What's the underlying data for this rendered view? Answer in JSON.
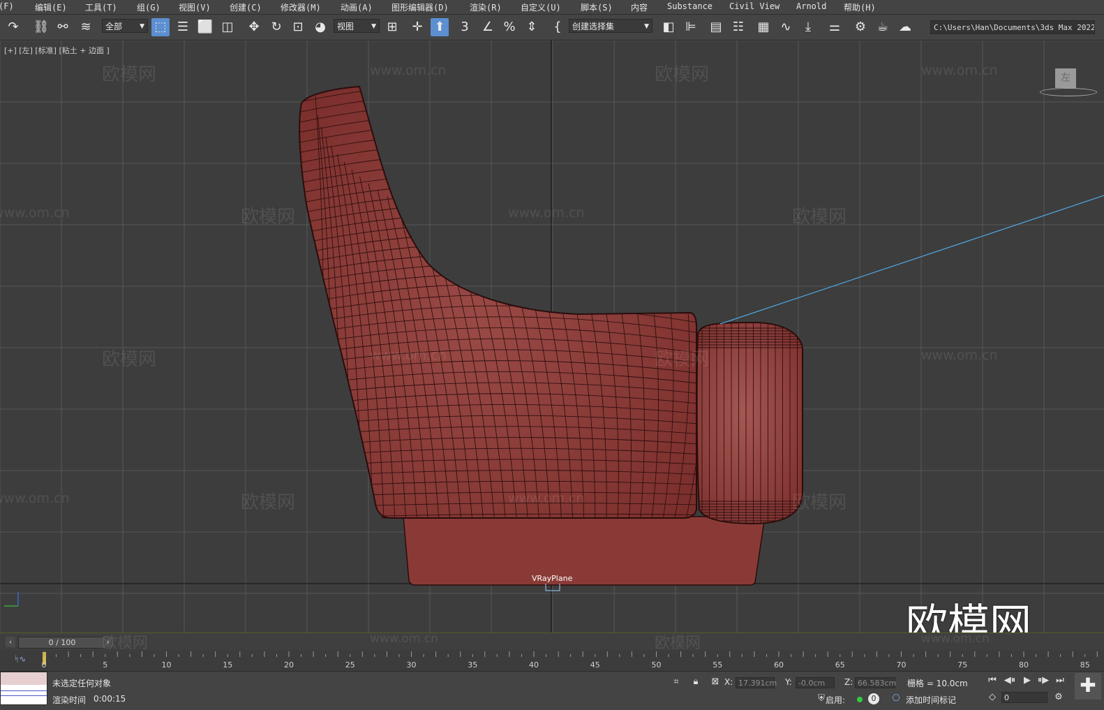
{
  "menu": {
    "items": [
      "(F)",
      "编辑(E)",
      "工具(T)",
      "组(G)",
      "视图(V)",
      "创建(C)",
      "修改器(M)",
      "动画(A)",
      "图形编辑器(D)",
      "渲染(R)",
      "自定义(U)",
      "脚本(S)",
      "内容",
      "Substance",
      "Civil View",
      "Arnold",
      "帮助(H)"
    ]
  },
  "toolbar": {
    "selection_filter": "全部",
    "ref_coord": "视图",
    "named_selection": "创建选择集",
    "project_path": "C:\\Users\\Han\\Documents\\3ds Max 2022",
    "snap_label": "3",
    "icons": [
      "redo-icon",
      "link-icon",
      "unlink-icon",
      "bind-space-warp-icon",
      "select-object-icon",
      "select-by-name-icon",
      "rect-region-icon",
      "window-crossing-icon",
      "move-icon",
      "rotate-icon",
      "scale-icon",
      "select-place-icon",
      "pivot-icon",
      "manipulate-icon",
      "keyboard-shortcut-icon",
      "snap-icon",
      "angle-snap-icon",
      "percent-snap-icon",
      "spinner-snap-icon",
      "edit-named-sel-icon",
      "mirror-icon",
      "align-icon",
      "layer-explorer-icon",
      "toggle-ribbon-icon",
      "curve-editor-icon",
      "schematic-icon",
      "material-editor-icon",
      "render-setup-icon",
      "render-frame-icon",
      "render-icon"
    ]
  },
  "viewport": {
    "label": "[+] [左] [标准] [粘土 + 边面 ]",
    "viewcube_face": "左",
    "object_label": "VRayPlane",
    "watermark_cn": "欧模网",
    "watermark_url": "www.om.cn",
    "logo_text": "欧模网"
  },
  "timeline": {
    "slider": "0 / 100",
    "ticks": [
      "0",
      "5",
      "10",
      "15",
      "20",
      "25",
      "30",
      "35",
      "40",
      "45",
      "50",
      "55",
      "60",
      "65",
      "70",
      "75",
      "80",
      "85"
    ]
  },
  "status": {
    "selection_msg": "未选定任何对象",
    "render_time_label": "渲染时间",
    "render_time": "0:00:15",
    "x_label": "X:",
    "x_value": "17.391cm",
    "y_label": "Y:",
    "y_value": "-0.0cm",
    "z_label": "Z:",
    "z_value": "66.583cm",
    "grid": "栅格 = 10.0cm",
    "enable_label": "启用:",
    "enable_value": "0",
    "add_time_tag": "添加时间标记",
    "frame_value": "0"
  },
  "colors": {
    "ui_bg": "#444444",
    "viewport_bg": "#3d3d3d",
    "grid": "#575757",
    "model": "#8a3a36",
    "wire": "#2a0d0c",
    "selection_blue": "#5b8fd0",
    "camera_line": "#4fa8e0"
  }
}
